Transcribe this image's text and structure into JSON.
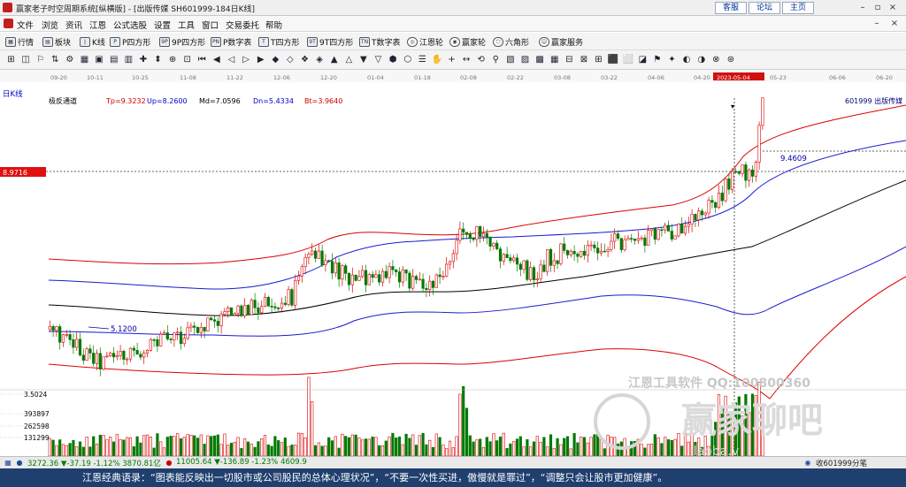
{
  "window": {
    "title": "赢家老子时空周期系统[纵横版] - [出版传媒  SH601999-184日K线]",
    "links": [
      "客服",
      "论坛",
      "主页"
    ]
  },
  "menu": [
    "文件",
    "浏览",
    "资讯",
    "江恩",
    "公式选股",
    "设置",
    "工具",
    "窗口",
    "交易委托",
    "帮助"
  ],
  "toolbar": [
    {
      "icon": "grid-icon",
      "label": "行情"
    },
    {
      "icon": "block-icon",
      "label": "板块"
    },
    {
      "icon": "kline-icon",
      "label": "K线"
    },
    {
      "icon": "p-icon",
      "label": "P四方形"
    },
    {
      "icon": "9p-icon",
      "label": "9P四方形"
    },
    {
      "icon": "pn-icon",
      "label": "P数字表"
    },
    {
      "icon": "t-icon",
      "label": "T四方形"
    },
    {
      "icon": "9t-icon",
      "label": "9T四方形"
    },
    {
      "icon": "tn-icon",
      "label": "T数字表"
    },
    {
      "icon": "wheel-icon",
      "label": "江恩轮"
    },
    {
      "icon": "winner-wheel-icon",
      "label": "赢家轮"
    },
    {
      "icon": "hexagon-icon",
      "label": "六角形"
    },
    {
      "icon": "service-icon",
      "label": "赢家服务"
    }
  ],
  "chart": {
    "period_label": "日K线",
    "x_dates": [
      "09-20",
      "10-11",
      "10-25",
      "11-08",
      "11-22",
      "12-06",
      "12-20",
      "01-04",
      "01-18",
      "02-08",
      "02-22",
      "03-08",
      "03-22",
      "04-06",
      "04-20",
      "2023-05-04",
      "05-23",
      "06-06",
      "06-20"
    ],
    "indicator": {
      "name": "极反通道",
      "tp": "Tp=9.3232",
      "up": "Up=8.2600",
      "md": "Md=7.0596",
      "dn": "Dn=5.4334",
      "bt": "Bt=3.9640"
    },
    "stock": "601999  出版传媒",
    "price_tag": "8.9716",
    "high_label": "9.4609",
    "low_label": "5.1200",
    "vol_axis": [
      "3.5024",
      "393897",
      "262598",
      "131299"
    ],
    "watermark": "江恩工具软件  QQ:100800360",
    "watermark2": "赢家聊吧",
    "watermark3": "ilaoba.v",
    "minute_label": "收601999分笔",
    "colors": {
      "up": "#dd0000",
      "down": "#007a00",
      "top": "#dd0000",
      "mid": "#1a1ad0",
      "md": "#000000"
    }
  },
  "status": {
    "sh": "3272.36 ▼-37.19 -1.12% 3870.81亿",
    "sz": "11005.64 ▼-136.89 -1.23% 4609.9"
  },
  "quote": "江恩经典语录：“图表能反映出一切股市或公司股民的总体心理状况”，“不要一次性买进，傲慢就是罪过”，“调整只会让股市更加健康”。"
}
